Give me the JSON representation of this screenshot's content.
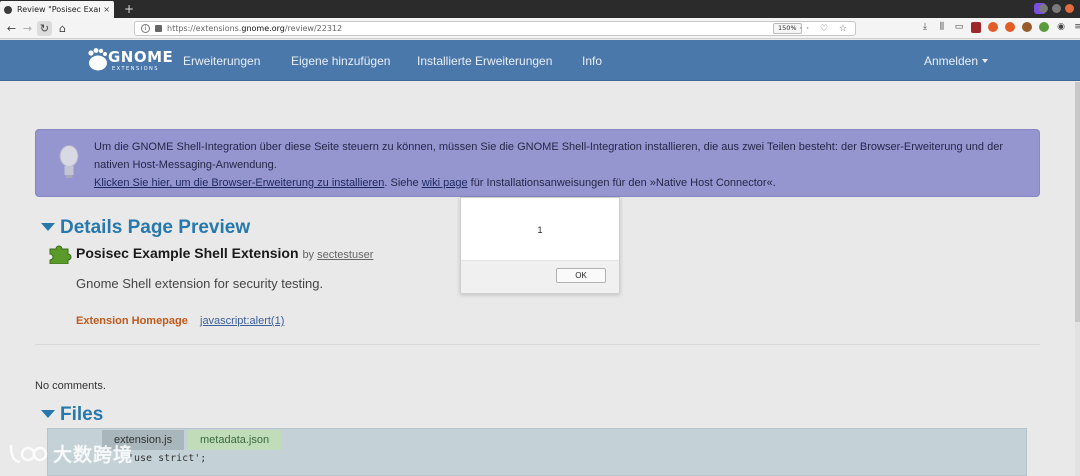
{
  "browser": {
    "tab_title": "Review \"Posisec Example Shell Extension\"",
    "tab_close": "×",
    "new_tab": "+",
    "url": "https://extensions.gnome.org/review/22312",
    "url_prefix": "https://extensions.",
    "url_domain": "gnome.org",
    "url_path": "/review/22312",
    "zoom": "150%",
    "url_icons": "··· ♡ ☆"
  },
  "header": {
    "logo_word": "GNOME",
    "logo_sub": "EXTENSIONS",
    "nav": [
      "Erweiterungen",
      "Eigene hinzufügen",
      "Installierte Erweiterungen",
      "Info"
    ],
    "login": "Anmelden"
  },
  "notice": {
    "line1": "Um die GNOME Shell-Integration über diese Seite steuern zu können, müssen Sie die GNOME Shell-Integration installieren, die aus zwei Teilen besteht: der Browser-Erweiterung und der nativen Host-Messaging-Anwendung.",
    "link_install": "Klicken Sie hier, um die Browser-Erweiterung zu installieren",
    "text_mid": ". Siehe ",
    "link_wiki": "wiki page",
    "text_end": " für Installationsanweisungen für den »Native Host Connector«."
  },
  "details": {
    "section_title": "Details Page Preview",
    "ext_name": "Posisec Example Shell Extension",
    "by": "by",
    "author": "sectestuser",
    "description": "Gnome Shell extension for security testing.",
    "homepage_label": "Extension Homepage",
    "homepage_link": "javascript:alert(1)"
  },
  "comments": {
    "empty": "No comments."
  },
  "files": {
    "section_title": "Files",
    "tabs": [
      "extension.js",
      "metadata.json"
    ],
    "code_line": "'use strict';"
  },
  "dialog": {
    "message": "1",
    "ok_label": "OK"
  },
  "watermark": {
    "text": "大数跨境"
  },
  "colors": {
    "header_blue": "#4a78ab",
    "notice_bg": "#9595d0",
    "link_orange": "#c05a1c",
    "title_blue": "#2778ac"
  }
}
